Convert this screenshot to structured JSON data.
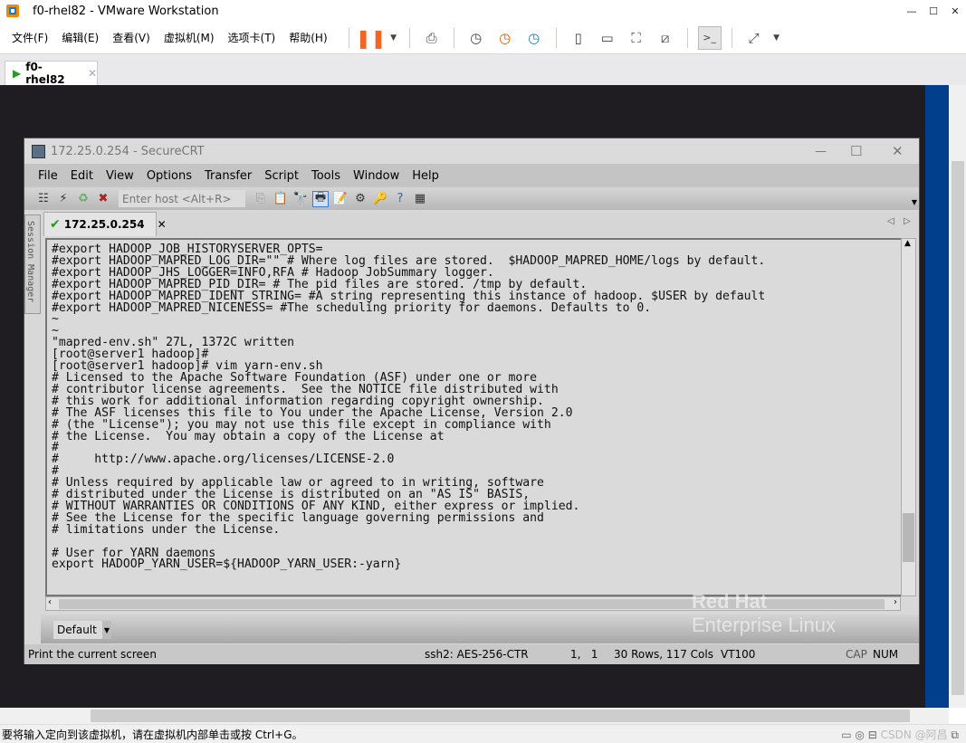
{
  "vmware": {
    "title": "f0-rhel82 - VMware Workstation",
    "menu": [
      "文件(F)",
      "编辑(E)",
      "查看(V)",
      "虚拟机(M)",
      "选项卡(T)",
      "帮助(H)"
    ],
    "tab": "f0-rhel82",
    "status": "要将输入定向到该虚拟机，请在虚拟机内部单击或按 Ctrl+G。",
    "watermark": "CSDN @阿昌",
    "accent": "#f26522"
  },
  "crt": {
    "title": "172.25.0.254 - SecureCRT",
    "menu": [
      "File",
      "Edit",
      "View",
      "Options",
      "Transfer",
      "Script",
      "Tools",
      "Window",
      "Help"
    ],
    "host_placeholder": "Enter host <Alt+R>",
    "tab": "172.25.0.254",
    "session_manager": "Session Manager",
    "button_bar": "Default",
    "status": {
      "message": "Print the current screen",
      "cipher": "ssh2: AES-256-CTR",
      "cursor": "1,   1",
      "size": "30 Rows, 117 Cols",
      "emulation": "VT100",
      "cap": "CAP",
      "num": "NUM"
    },
    "terminal_lines": [
      "#export HADOOP_JOB_HISTORYSERVER_OPTS=",
      "#export HADOOP_MAPRED_LOG_DIR=\"\" # Where log files are stored.  $HADOOP_MAPRED_HOME/logs by default.",
      "#export HADOOP_JHS_LOGGER=INFO,RFA # Hadoop JobSummary logger.",
      "#export HADOOP_MAPRED_PID_DIR= # The pid files are stored. /tmp by default.",
      "#export HADOOP_MAPRED_IDENT_STRING= #A string representing this instance of hadoop. $USER by default",
      "#export HADOOP_MAPRED_NICENESS= #The scheduling priority for daemons. Defaults to 0.",
      "~",
      "~",
      "\"mapred-env.sh\" 27L, 1372C written",
      "[root@server1 hadoop]#",
      "[root@server1 hadoop]# vim yarn-env.sh",
      "# Licensed to the Apache Software Foundation (ASF) under one or more",
      "# contributor license agreements.  See the NOTICE file distributed with",
      "# this work for additional information regarding copyright ownership.",
      "# The ASF licenses this file to You under the Apache License, Version 2.0",
      "# (the \"License\"); you may not use this file except in compliance with",
      "# the License.  You may obtain a copy of the License at",
      "#",
      "#     http://www.apache.org/licenses/LICENSE-2.0",
      "#",
      "# Unless required by applicable law or agreed to in writing, software",
      "# distributed under the License is distributed on an \"AS IS\" BASIS,",
      "# WITHOUT WARRANTIES OR CONDITIONS OF ANY KIND, either express or implied.",
      "# See the License for the specific language governing permissions and",
      "# limitations under the License.",
      "",
      "# User for YARN daemons",
      "export HADOOP_YARN_USER=${HADOOP_YARN_USER:-yarn}"
    ]
  },
  "wallpaper": {
    "brand1": "Red Hat",
    "brand2": "Enterprise Linux"
  }
}
